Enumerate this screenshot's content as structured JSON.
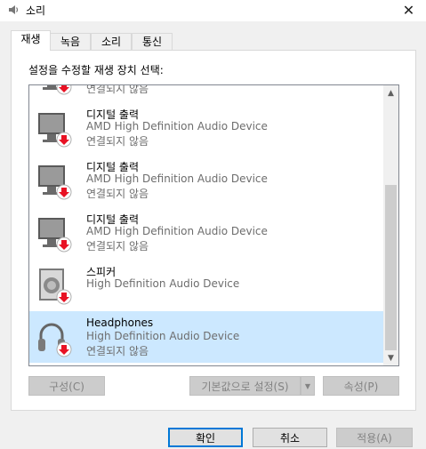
{
  "window": {
    "title": "소리"
  },
  "tabs": [
    {
      "label": "재생",
      "active": true
    },
    {
      "label": "녹음",
      "active": false
    },
    {
      "label": "소리",
      "active": false
    },
    {
      "label": "통신",
      "active": false
    }
  ],
  "instruction": "설정을 수정할 재생 장치 선택:",
  "devices": [
    {
      "name": "",
      "description": "",
      "status": "연결되지 않음",
      "icon": "monitor-icon",
      "selected": false
    },
    {
      "name": "디지털 출력",
      "description": "AMD High Definition Audio Device",
      "status": "연결되지 않음",
      "icon": "monitor-icon",
      "selected": false
    },
    {
      "name": "디지털 출력",
      "description": "AMD High Definition Audio Device",
      "status": "연결되지 않음",
      "icon": "monitor-icon",
      "selected": false
    },
    {
      "name": "디지털 출력",
      "description": "AMD High Definition Audio Device",
      "status": "연결되지 않음",
      "icon": "monitor-icon",
      "selected": false
    },
    {
      "name": "스피커",
      "description": "High Definition Audio Device",
      "status": "",
      "icon": "speaker-icon",
      "selected": false
    },
    {
      "name": "Headphones",
      "description": "High Definition Audio Device",
      "status": "연결되지 않음",
      "icon": "headphones-icon",
      "selected": true
    }
  ],
  "buttons": {
    "configure": "구성(C)",
    "set_default": "기본값으로 설정(S)",
    "properties": "속성(P)",
    "ok": "확인",
    "cancel": "취소",
    "apply": "적용(A)"
  },
  "colors": {
    "accent": "#0078d7",
    "badge": "#e81123",
    "selection": "#cce8ff"
  },
  "icons": {
    "title": "speaker-icon",
    "status_badge": "down-arrow-badge-icon",
    "close": "close-icon"
  }
}
